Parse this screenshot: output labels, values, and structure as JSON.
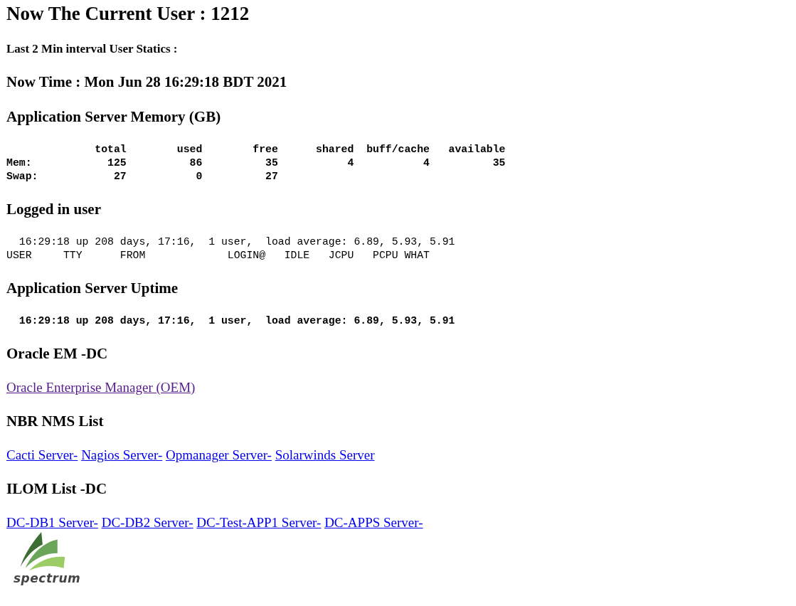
{
  "title": "Now The Current User : 1212",
  "subtitle": "Last 2 Min interval User Statics :",
  "now_time": "Now Time : Mon Jun 28 16:29:18 BDT 2021",
  "sections": [
    {
      "heading": "Application Server Memory (GB)",
      "kind": "pre",
      "bold": true,
      "lines": [
        "              total        used        free      shared  buff/cache   available",
        "Mem:            125          86          35           4           4          35",
        "Swap:            27           0          27"
      ]
    },
    {
      "heading": "Logged in user",
      "kind": "pre",
      "bold": false,
      "lines": [
        "  16:29:18 up 208 days, 17:16,  1 user,  load average: 6.89, 5.93, 5.91",
        "USER     TTY      FROM             LOGIN@   IDLE   JCPU   PCPU WHAT"
      ]
    },
    {
      "heading": "Application Server Uptime",
      "kind": "pre",
      "bold": true,
      "lines": [
        "  16:29:18 up 208 days, 17:16,  1 user,  load average: 6.89, 5.93, 5.91"
      ]
    },
    {
      "heading": "Oracle EM -DC",
      "kind": "links",
      "links": [
        {
          "label": "Oracle Enterprise Manager (OEM)",
          "visited": true
        }
      ]
    },
    {
      "heading": "NBR NMS List",
      "kind": "links",
      "links": [
        {
          "label": "Cacti Server-",
          "visited": false
        },
        {
          "label": "Nagios Server-",
          "visited": false
        },
        {
          "label": "Opmanager Server-",
          "visited": false
        },
        {
          "label": "Solarwinds Server",
          "visited": false
        }
      ]
    },
    {
      "heading": "ILOM List -DC",
      "kind": "links",
      "links": [
        {
          "label": "DC-DB1 Server-",
          "visited": false
        },
        {
          "label": "DC-DB2 Server-",
          "visited": false
        },
        {
          "label": "DC-Test-APP1 Server-",
          "visited": false
        },
        {
          "label": "DC-APPS Server-",
          "visited": false
        }
      ]
    }
  ],
  "logo": {
    "text": "spectrum"
  }
}
